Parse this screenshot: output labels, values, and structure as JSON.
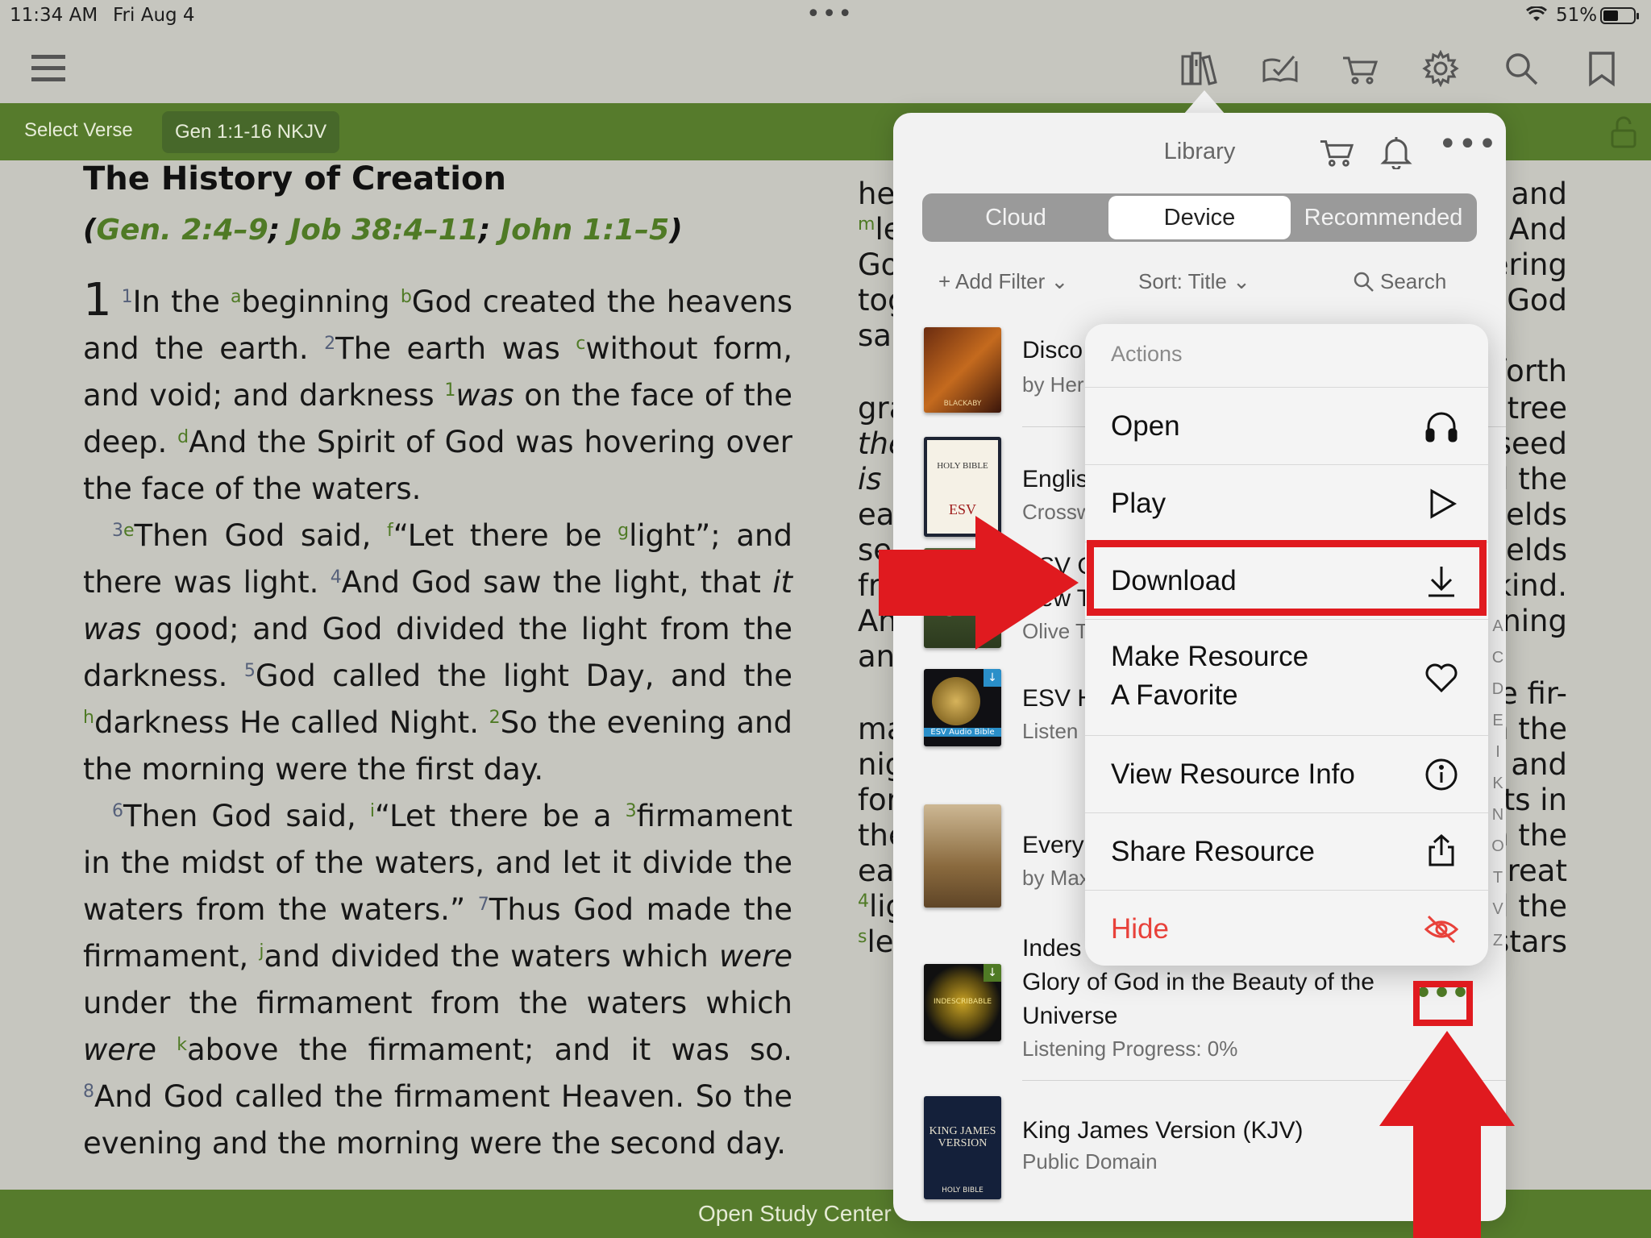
{
  "status": {
    "time": "11:34 AM",
    "date": "Fri Aug 4",
    "battery": "51%"
  },
  "versebar": {
    "select_verse": "Select Verse",
    "reference": "Gen 1:1-16 NKJV"
  },
  "reading": {
    "heading": "The History of Creation",
    "crossrefs": {
      "open": "(",
      "ref1": "Gen. 2:4–9",
      "sep1": "; ",
      "ref2": "Job 38:4–11",
      "sep2": "; ",
      "ref3": "John 1:1–5",
      "close": ")"
    },
    "chapter": "1",
    "segments": {
      "v1n": "1",
      "v1a": "a",
      "v1t1": "In the ",
      "v1b": "b",
      "v1t2": "beginning ",
      "v1t3": "God created the heavens and the earth. ",
      "v2n": "2",
      "v2t1": "The earth was ",
      "v2c": "c",
      "v2t2": "without form, and void; and darkness ",
      "v2s": "1",
      "v2w": "was",
      "v2t3": " on the face of the deep. ",
      "v2d": "d",
      "v2t4": "And the Spirit of God was hovering over the face of the waters.",
      "v3n": "3",
      "v3e": "e",
      "v3t1": "Then God said, ",
      "v3f": "f",
      "v3t2": "“Let there be ",
      "v3g": "g",
      "v3t3": "light”; and there was light. ",
      "v4n": "4",
      "v4t1": "And God saw the light, that ",
      "v4it": "it",
      "v4sp": " ",
      "v4was": "was",
      "v4t2": " good; and God divided the light from the darkness. ",
      "v5n": "5",
      "v5t1": "God called the light Day, and the ",
      "v5h": "h",
      "v5t2": "darkness He called Night. ",
      "v5s": "2",
      "v5t3": "So the evening and the morning were the first day.",
      "v6n": "6",
      "v6t1": "Then God said, ",
      "v6i": "i",
      "v6t2": "“Let there be a ",
      "v6s": "3",
      "v6t3": "firmament in the midst of the waters, and let it divide the waters from the waters.” ",
      "v7n": "7",
      "v7t1": "Thus God made the firmament, ",
      "v7j": "j",
      "v7t2": "and divided the waters which ",
      "v7were1": "were",
      "v7t3": " under the firmament from the waters which ",
      "v7were2": "were",
      "v7sp": " ",
      "v7k": "k",
      "v7t4": "above the firmament; and it was so. ",
      "v8n": "8",
      "v8t1": "And God called the firmament Heaven. So the evening and the morning were the second day."
    }
  },
  "rightcol": {
    "left_fragments": [
      "he",
      "le",
      "Go",
      "tog",
      "sa",
      "gra",
      "the",
      "is",
      "ea",
      "see",
      "fru",
      "An",
      "an",
      "ma",
      "nig",
      "for",
      "the",
      "ea",
      "lig",
      "le"
    ],
    "left_sup": [
      "m",
      "4",
      "s"
    ],
    "right_fragments": [
      "and",
      "And",
      "ering",
      "God",
      "forth",
      "tree",
      "seed",
      "d the",
      "ields",
      "ields",
      "kind.",
      "ning",
      "e fir-",
      "n the",
      "and",
      "ts in",
      "n the",
      "great",
      "d the",
      "stars"
    ]
  },
  "bottombar": {
    "label": "Open Study Center"
  },
  "library": {
    "title": "Library",
    "tabs": [
      "Cloud",
      "Device",
      "Recommended"
    ],
    "active_tab": "Device",
    "add_filter": "+ Add Filter",
    "sort": "Sort: Title",
    "search": "Search",
    "items": [
      {
        "title": "Disco",
        "subtitle": "by Her"
      },
      {
        "title": "Englis",
        "subtitle": "Crossw"
      },
      {
        "title": "New T",
        "subtitle": "Olive T"
      },
      {
        "title": "ESV H",
        "subtitle": "Listen"
      },
      {
        "title": "Every",
        "subtitle": "by Max"
      },
      {
        "title": "Indes",
        "title2": "Glory of God in the Beauty of the",
        "title3": "Universe",
        "subtitle": "Listening Progress: 0%"
      },
      {
        "title": "King James Version (KJV)",
        "subtitle": "Public Domain"
      }
    ],
    "partial_item_title": "ESV G",
    "alpha_index": [
      "A",
      "C",
      "D",
      "E",
      "I",
      "K",
      "N",
      "O",
      "T",
      "V",
      "Z"
    ],
    "more_label": "•••"
  },
  "actions": {
    "header": "Actions",
    "items": [
      {
        "label": "Open"
      },
      {
        "label": "Play"
      },
      {
        "label": "Download"
      },
      {
        "label": "Make Resource",
        "label2": "A Favorite"
      },
      {
        "label": "View Resource Info"
      },
      {
        "label": "Share Resource"
      },
      {
        "label": "Hide"
      }
    ]
  },
  "covers": {
    "c1_text": "BLACKABY",
    "c2_text": "HOLY BIBLE",
    "c2_sub": "ESV",
    "c4_text": "ESV Audio Bible",
    "c6_text": "INDESCRIBABLE",
    "c7_text": "KING JAMES VERSION",
    "c7_sub": "HOLY BIBLE"
  },
  "colors": {
    "accent_green": "#567b2c",
    "link_green": "#4f7a25",
    "annotation_red": "#e01a1f",
    "destructive_red": "#e8413a"
  }
}
